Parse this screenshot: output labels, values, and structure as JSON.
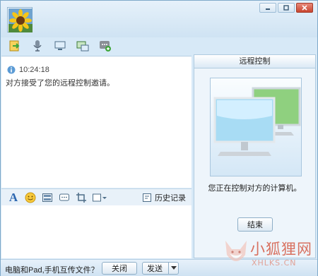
{
  "chat": {
    "timestamp": "10:24:18",
    "message": "对方接受了您的远程控制邀请。"
  },
  "input_toolbar": {
    "font_icon_label": "A",
    "history_label": "历史记录"
  },
  "remote_panel": {
    "title": "远程控制",
    "status": "您正在控制对方的计算机。",
    "end_button": "结束"
  },
  "bottom_bar": {
    "hint": "电脑和Pad,手机互传文件？",
    "close_button": "关闭",
    "send_button": "发送"
  },
  "watermark": {
    "text_cn": "小狐狸网",
    "text_en": "XHLKS.CN"
  },
  "colors": {
    "window_bg": "#d7e9f7",
    "accent_green": "#3fa63a",
    "watermark": "#d55a45"
  },
  "icons": {
    "toolbar": [
      "file-transfer-icon",
      "microphone-icon",
      "video-icon",
      "remote-desktop-icon",
      "app-add-icon"
    ],
    "input": [
      "font-icon",
      "emoji-icon",
      "image-icon",
      "shake-icon",
      "screenshot-icon",
      "more-icon"
    ]
  }
}
